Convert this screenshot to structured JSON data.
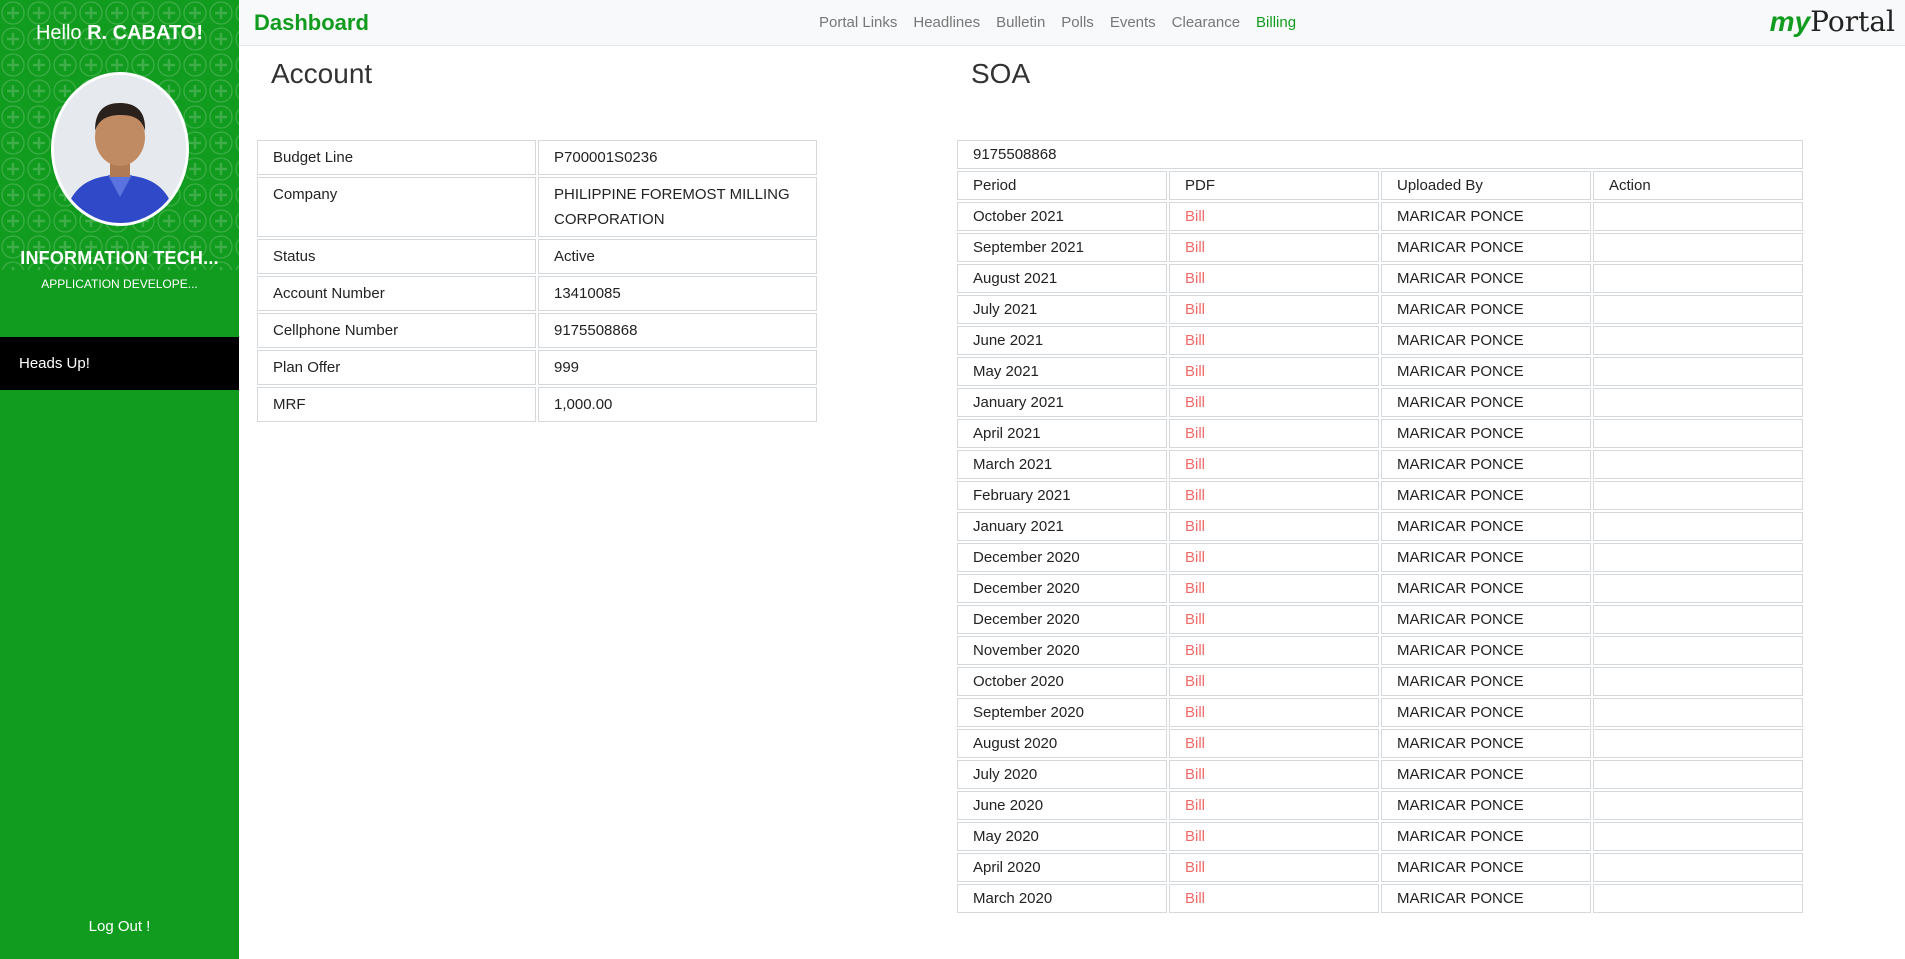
{
  "sidebar": {
    "greeting_prefix": "Hello",
    "user_name": "R. CABATO!",
    "department": "INFORMATION TECH...",
    "role": "APPLICATION DEVELOPE...",
    "heads_up": "Heads Up!",
    "logout": "Log Out !"
  },
  "nav": {
    "brand": "Dashboard",
    "links": [
      "Portal Links",
      "Headlines",
      "Bulletin",
      "Polls",
      "Events",
      "Clearance",
      "Billing"
    ],
    "active": "Billing",
    "logo_my": "my",
    "logo_portal": "Portal"
  },
  "account": {
    "title": "Account",
    "rows": [
      {
        "label": "Budget Line",
        "value": "P700001S0236"
      },
      {
        "label": "Company",
        "value": "PHILIPPINE FOREMOST MILLING CORPORATION"
      },
      {
        "label": "Status",
        "value": "Active"
      },
      {
        "label": "Account Number",
        "value": "13410085"
      },
      {
        "label": "Cellphone Number",
        "value": "9175508868"
      },
      {
        "label": "Plan Offer",
        "value": "999"
      },
      {
        "label": "MRF",
        "value": "1,000.00"
      }
    ]
  },
  "soa": {
    "title": "SOA",
    "number": "9175508868",
    "headers": [
      "Period",
      "PDF",
      "Uploaded By",
      "Action"
    ],
    "rows": [
      {
        "period": "October 2021",
        "pdf": "Bill",
        "uploaded_by": "MARICAR PONCE",
        "action": ""
      },
      {
        "period": "September 2021",
        "pdf": "Bill",
        "uploaded_by": "MARICAR PONCE",
        "action": ""
      },
      {
        "period": "August 2021",
        "pdf": "Bill",
        "uploaded_by": "MARICAR PONCE",
        "action": ""
      },
      {
        "period": "July 2021",
        "pdf": "Bill",
        "uploaded_by": "MARICAR PONCE",
        "action": ""
      },
      {
        "period": "June 2021",
        "pdf": "Bill",
        "uploaded_by": "MARICAR PONCE",
        "action": ""
      },
      {
        "period": "May 2021",
        "pdf": "Bill",
        "uploaded_by": "MARICAR PONCE",
        "action": ""
      },
      {
        "period": "January 2021",
        "pdf": "Bill",
        "uploaded_by": "MARICAR PONCE",
        "action": ""
      },
      {
        "period": "April 2021",
        "pdf": "Bill",
        "uploaded_by": "MARICAR PONCE",
        "action": ""
      },
      {
        "period": "March 2021",
        "pdf": "Bill",
        "uploaded_by": "MARICAR PONCE",
        "action": ""
      },
      {
        "period": "February 2021",
        "pdf": "Bill",
        "uploaded_by": "MARICAR PONCE",
        "action": ""
      },
      {
        "period": "January 2021",
        "pdf": "Bill",
        "uploaded_by": "MARICAR PONCE",
        "action": ""
      },
      {
        "period": "December 2020",
        "pdf": "Bill",
        "uploaded_by": "MARICAR PONCE",
        "action": ""
      },
      {
        "period": "December 2020",
        "pdf": "Bill",
        "uploaded_by": "MARICAR PONCE",
        "action": ""
      },
      {
        "period": "December 2020",
        "pdf": "Bill",
        "uploaded_by": "MARICAR PONCE",
        "action": ""
      },
      {
        "period": "November 2020",
        "pdf": "Bill",
        "uploaded_by": "MARICAR PONCE",
        "action": ""
      },
      {
        "period": "October 2020",
        "pdf": "Bill",
        "uploaded_by": "MARICAR PONCE",
        "action": ""
      },
      {
        "period": "September 2020",
        "pdf": "Bill",
        "uploaded_by": "MARICAR PONCE",
        "action": ""
      },
      {
        "period": "August 2020",
        "pdf": "Bill",
        "uploaded_by": "MARICAR PONCE",
        "action": ""
      },
      {
        "period": "July 2020",
        "pdf": "Bill",
        "uploaded_by": "MARICAR PONCE",
        "action": ""
      },
      {
        "period": "June 2020",
        "pdf": "Bill",
        "uploaded_by": "MARICAR PONCE",
        "action": ""
      },
      {
        "period": "May 2020",
        "pdf": "Bill",
        "uploaded_by": "MARICAR PONCE",
        "action": ""
      },
      {
        "period": "April 2020",
        "pdf": "Bill",
        "uploaded_by": "MARICAR PONCE",
        "action": ""
      },
      {
        "period": "March 2020",
        "pdf": "Bill",
        "uploaded_by": "MARICAR PONCE",
        "action": ""
      }
    ]
  },
  "colors": {
    "brand_green": "#129c1f",
    "bill_link": "#f06a6a",
    "headsup_bg": "#000000"
  }
}
